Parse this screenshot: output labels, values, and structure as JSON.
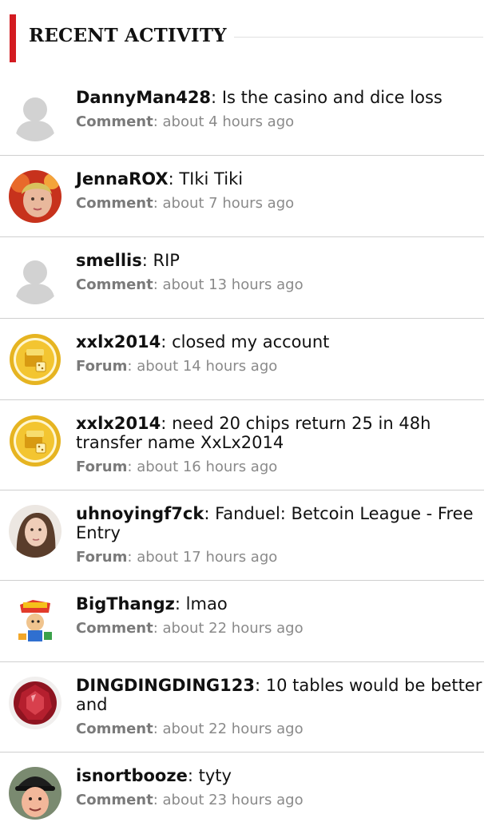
{
  "header": {
    "title": "RECENT ACTIVITY"
  },
  "items": [
    {
      "user": "DannyMan428",
      "text": "Is the casino and dice loss",
      "type": "Comment",
      "time": "about 4 hours ago",
      "avatar": "default-avatar"
    },
    {
      "user": "JennaROX",
      "text": "TIki Tiki",
      "type": "Comment",
      "time": "about 7 hours ago",
      "avatar": "user-photo"
    },
    {
      "user": "smellis",
      "text": "RIP",
      "type": "Comment",
      "time": "about 13 hours ago",
      "avatar": "default-avatar"
    },
    {
      "user": "xxlx2014",
      "text": "closed my account",
      "type": "Forum",
      "time": "about 14 hours ago",
      "avatar": "gold-chips-badge"
    },
    {
      "user": "xxlx2014",
      "text": "need 20 chips return 25 in 48h transfer name XxLx2014",
      "type": "Forum",
      "time": "about 16 hours ago",
      "avatar": "gold-chips-badge"
    },
    {
      "user": "uhnoyingf7ck",
      "text": "Fanduel: Betcoin League - Free Entry",
      "type": "Forum",
      "time": "about 17 hours ago",
      "avatar": "user-photo"
    },
    {
      "user": "BigThangz",
      "text": "lmao",
      "type": "Comment",
      "time": "about 22 hours ago",
      "avatar": "cartoon-avatar"
    },
    {
      "user": "DINGDINGDING123",
      "text": "10 tables would be better and",
      "type": "Comment",
      "time": "about 22 hours ago",
      "avatar": "ruby-gem"
    },
    {
      "user": "isnortbooze",
      "text": "tyty",
      "type": "Comment",
      "time": "about 23 hours ago",
      "avatar": "user-photo"
    }
  ],
  "colors": {
    "accent": "#d31b21",
    "divider": "#cfcfcf",
    "meta_text": "#8a8a8a"
  }
}
